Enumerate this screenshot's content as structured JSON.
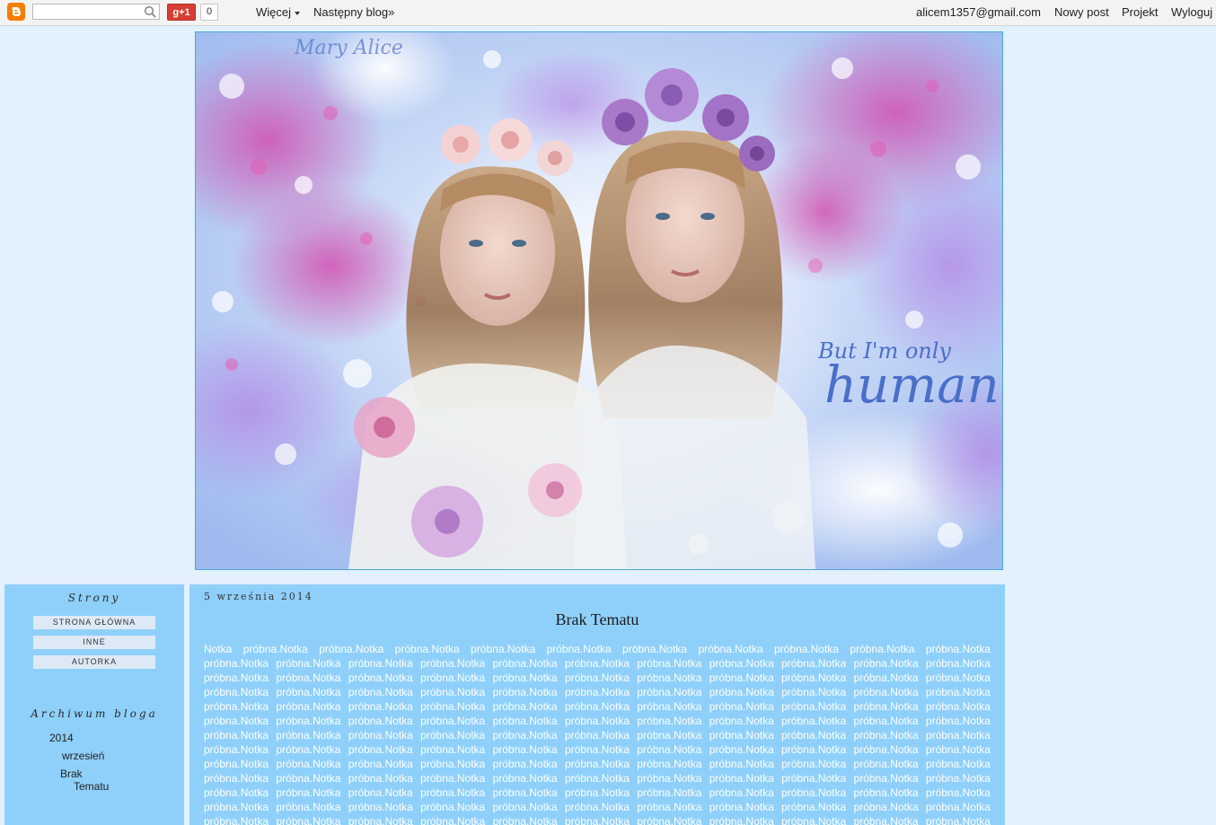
{
  "navbar": {
    "plus_label": "g+1",
    "plus_count": "0",
    "more_label": "Więcej",
    "next_blog_label": "Następny blog»",
    "email": "alicem1357@gmail.com",
    "new_post": "Nowy post",
    "design": "Projekt",
    "logout": "Wyloguj"
  },
  "header": {
    "signature": "Mary Alice",
    "tagline_top": "But I'm only",
    "tagline_bottom": "human"
  },
  "sidebar": {
    "pages_title": "Strony",
    "pages": [
      "STRONA GŁÓWNA",
      "INNE",
      "AUTORKA"
    ],
    "archive_title": "Archiwum bloga",
    "archive_year": "2014",
    "archive_month": "wrzesień",
    "archive_post_line1": "Brak",
    "archive_post_line2": "Tematu"
  },
  "post": {
    "date": "5 września 2014",
    "title": "Brak Tematu",
    "body_first_row": [
      "Notka",
      "próbna.Notka",
      "próbna.Notka",
      "próbna.Notka",
      "próbna.Notka",
      "próbna.Notka",
      "próbna.Notka",
      "próbna.Notka",
      "próbna.Notka",
      "próbna.Notka",
      "próbna.Notka"
    ],
    "body_row": [
      "próbna.Notka",
      "próbna.Notka",
      "próbna.Notka",
      "próbna.Notka",
      "próbna.Notka",
      "próbna.Notka",
      "próbna.Notka",
      "próbna.Notka",
      "próbna.Notka",
      "próbna.Notka",
      "próbna.Notka"
    ],
    "body_row_count": 12
  },
  "colors": {
    "page_bg": "#e3f0fd",
    "panel_bg": "#8fd0fb",
    "blogger_orange": "#f57d00",
    "gplus_red": "#d73d32"
  }
}
